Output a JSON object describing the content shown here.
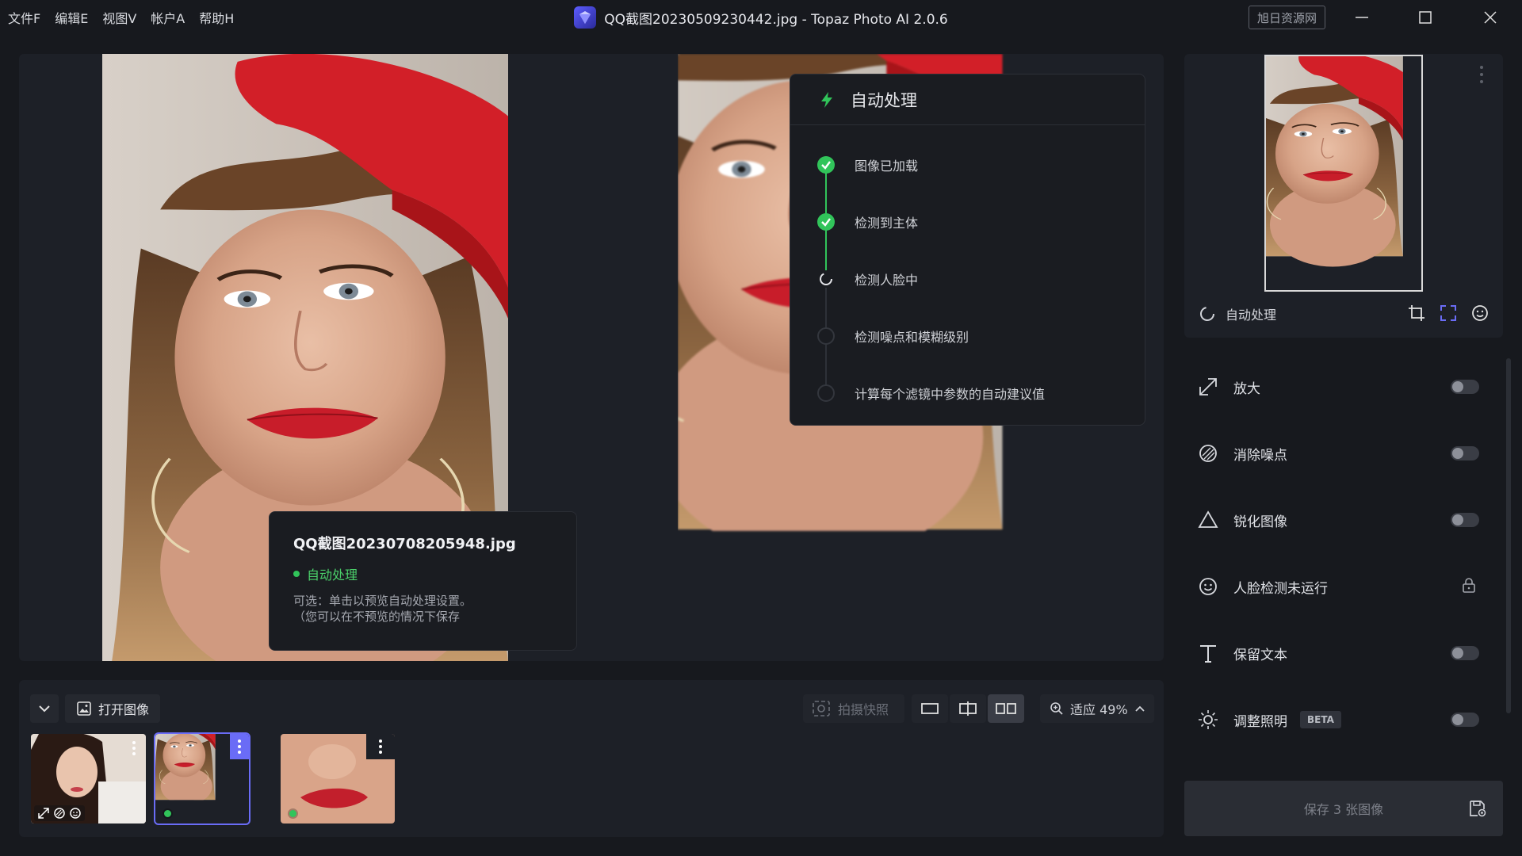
{
  "menu": [
    "文件F",
    "编辑E",
    "视图V",
    "帐户A",
    "帮助H"
  ],
  "window": {
    "title": "QQ截图20230509230442.jpg - Topaz Photo AI 2.0.6",
    "site_badge": "旭日资源网"
  },
  "info_card": {
    "filename": "QQ截图20230708205948.jpg",
    "status": "自动处理",
    "note_line1": "可选：单击以预览自动处理设置。",
    "note_line2": "（您可以在不预览的情况下保存"
  },
  "auto_panel": {
    "title": "自动处理",
    "steps": [
      {
        "label": "图像已加载",
        "state": "done"
      },
      {
        "label": "检测到主体",
        "state": "done"
      },
      {
        "label": "检测人脸中",
        "state": "running"
      },
      {
        "label": "检测噪点和模糊级别",
        "state": "pending"
      },
      {
        "label": "计算每个滤镜中参数的自动建议值",
        "state": "pending"
      }
    ]
  },
  "bottom": {
    "open_image": "打开图像",
    "snapshot": "拍摄快照",
    "zoom_label": "适应 49%",
    "active_view": "side-by-side"
  },
  "sidebar": {
    "status": "自动处理",
    "filters": [
      {
        "label": "放大",
        "icon": "upscale-icon",
        "control": "toggle",
        "on": false
      },
      {
        "label": "消除噪点",
        "icon": "denoise-icon",
        "control": "toggle",
        "on": false
      },
      {
        "label": "锐化图像",
        "icon": "sharpen-icon",
        "control": "toggle",
        "on": false
      },
      {
        "label": "人脸检测未运行",
        "icon": "face-icon",
        "control": "lock"
      },
      {
        "label": "保留文本",
        "icon": "text-icon",
        "control": "toggle",
        "on": false
      },
      {
        "label": "调整照明",
        "icon": "light-icon",
        "control": "toggle",
        "on": false,
        "badge": "BETA"
      }
    ],
    "save_label": "保存 3 张图像"
  },
  "colors": {
    "accent": "#6a6cf6",
    "success": "#31c45a",
    "background": "#17191e",
    "panel": "#1d2027"
  }
}
